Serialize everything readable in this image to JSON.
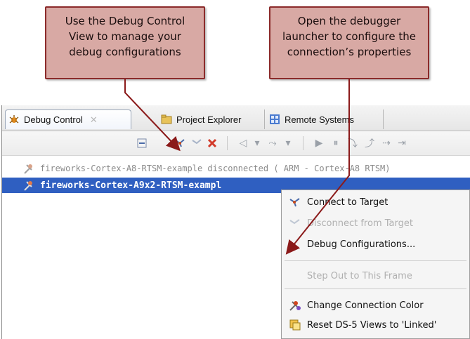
{
  "callouts": {
    "left": {
      "line1": "Use the Debug Control",
      "line2": "View to manage your",
      "line3": "debug configurations"
    },
    "right": {
      "line1": "Open the debugger",
      "line2": "launcher to configure the",
      "line3": "connection’s properties"
    }
  },
  "tabs": {
    "debug_control": "Debug Control",
    "debug_control_close": "✕",
    "project_explorer": "Project Explorer",
    "remote_systems": "Remote Systems"
  },
  "connections": [
    {
      "label": "fireworks-Cortex-A8-RTSM-example disconnected ( ARM - Cortex-A8 RTSM)"
    },
    {
      "label": "fireworks-Cortex-A9x2-RTSM-exampl"
    }
  ],
  "context_menu": {
    "items": [
      {
        "label": "Connect to Target",
        "enabled": true
      },
      {
        "label": "Disconnect from Target",
        "enabled": false
      },
      {
        "label": "Debug Configurations...",
        "enabled": true
      },
      {
        "label": "Step Out to This Frame",
        "enabled": false
      },
      {
        "label": "Change Connection Color",
        "enabled": true
      },
      {
        "label": "Reset DS-5 Views to 'Linked'",
        "enabled": true
      }
    ]
  },
  "colors": {
    "callout_fill": "#d8a9a4",
    "callout_border": "#8b2b2b",
    "arrow": "#8b1a1a",
    "selection": "#2f5fc1"
  },
  "icons": {
    "debug_control_tab": "debug-control-icon",
    "project_explorer_tab": "project-explorer-icon",
    "remote_systems_tab": "remote-systems-icon",
    "connection": "connection-icon",
    "connect": "connect-icon",
    "disconnect": "disconnect-icon",
    "color": "connection-color-icon",
    "reset_views": "reset-views-icon"
  }
}
